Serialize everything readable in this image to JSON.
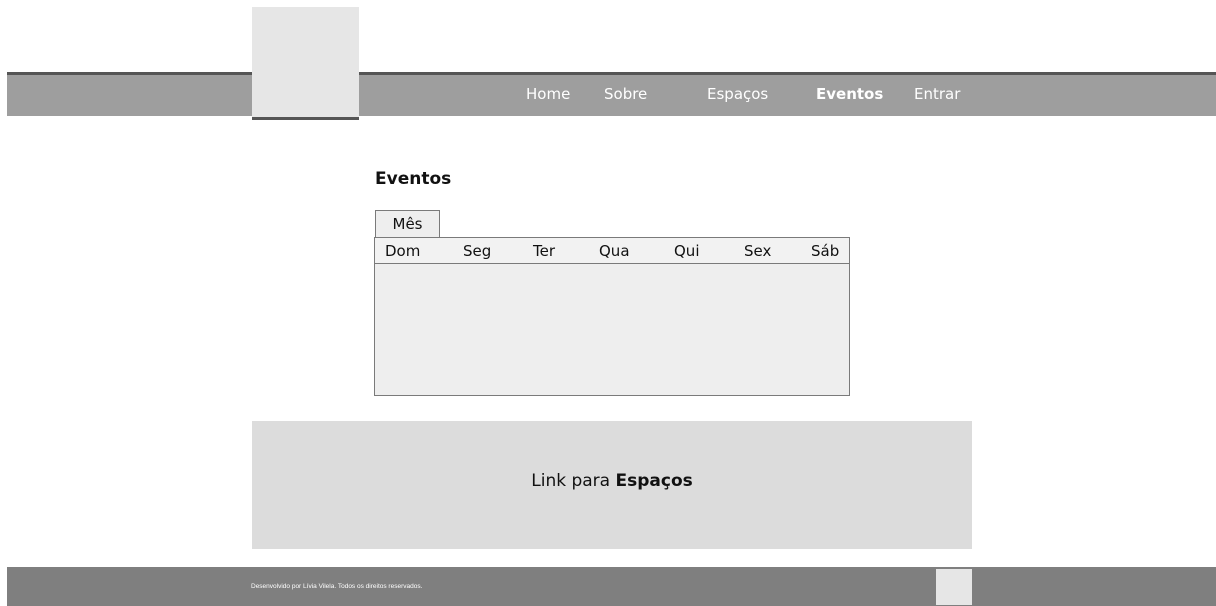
{
  "nav": {
    "items": [
      {
        "label": "Home"
      },
      {
        "label": "Sobre"
      },
      {
        "label": "Espaços"
      },
      {
        "label": "Eventos",
        "active": true
      },
      {
        "label": "Entrar"
      }
    ]
  },
  "main": {
    "title": "Eventos",
    "tab_label": "Mês",
    "days": [
      "Dom",
      "Seg",
      "Ter",
      "Qua",
      "Qui",
      "Sex",
      "Sáb"
    ]
  },
  "link_panel": {
    "prefix": "Link para ",
    "target": "Espaços"
  },
  "footer": {
    "text": "Desenvolvido por Lívia Vilela. Todos os direitos reservados."
  },
  "colors": {
    "navbar": "#9e9e9e",
    "nav_border": "#555555",
    "placeholder": "#e6e6e6",
    "panel": "#dcdcdc",
    "footer": "#7f7f7f"
  }
}
